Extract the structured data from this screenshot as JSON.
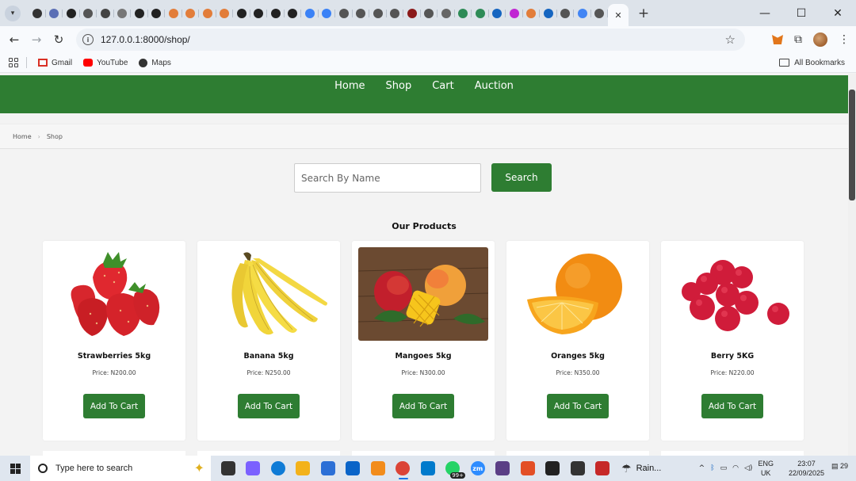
{
  "browser": {
    "tab_menu_icon": "chevron-down-icon",
    "active_tab_close_icon": "close-icon",
    "new_tab_label": "+",
    "window_controls": {
      "minimize": "—",
      "maximize": "☐",
      "close": "✕"
    },
    "url": "127.0.0.1:8000/shop/",
    "mini_tab_colors": [
      "#333333",
      "#5b6fb5",
      "#222222",
      "#555555",
      "#444444",
      "#777777",
      "#222222",
      "#222222",
      "#e27d3a",
      "#e27d3a",
      "#e27d3a",
      "#e27d3a",
      "#222222",
      "#222222",
      "#222222",
      "#222222",
      "#3b82f6",
      "#3b82f6",
      "#555555",
      "#555555",
      "#555555",
      "#555555",
      "#8b1a1a",
      "#555555",
      "#666666",
      "#2e8b57",
      "#2e8b57",
      "#1565c0",
      "#c026d3",
      "#e27d3a",
      "#1565c0",
      "#555555",
      "#4285f4",
      "#555555"
    ],
    "bookmarks": [
      {
        "label": "Gmail",
        "icon": "gmail-icon",
        "color": "#d93025"
      },
      {
        "label": "YouTube",
        "icon": "youtube-icon",
        "color": "#ff0000"
      },
      {
        "label": "Maps",
        "icon": "globe-icon",
        "color": "#333333"
      }
    ],
    "all_bookmarks_label": "All Bookmarks"
  },
  "site": {
    "nav": [
      "Home",
      "Shop",
      "Cart",
      "Auction"
    ],
    "breadcrumb": [
      "Home",
      "Shop"
    ],
    "breadcrumb_separator": "›",
    "search_placeholder": "Search By Name",
    "search_button": "Search",
    "section_title": "Our Products",
    "accent_color": "#2e7d32",
    "products": [
      {
        "name": "Strawberries 5kg",
        "price": "Price: N200.00",
        "button": "Add To Cart",
        "image": "strawberries-image"
      },
      {
        "name": "Banana 5kg",
        "price": "Price: N250.00",
        "button": "Add To Cart",
        "image": "banana-image"
      },
      {
        "name": "Mangoes 5kg",
        "price": "Price: N300.00",
        "button": "Add To Cart",
        "image": "mangoes-image"
      },
      {
        "name": "Oranges 5kg",
        "price": "Price: N350.00",
        "button": "Add To Cart",
        "image": "oranges-image"
      },
      {
        "name": "Berry 5KG",
        "price": "Price: N220.00",
        "button": "Add To Cart",
        "image": "raspberries-image"
      }
    ]
  },
  "taskbar": {
    "search_placeholder": "Type here to search",
    "apps": [
      {
        "name": "task-view-icon",
        "color": "#333333"
      },
      {
        "name": "copilot-icon",
        "color": "#7b61ff"
      },
      {
        "name": "edge-icon",
        "color": "#0f7bd6"
      },
      {
        "name": "file-explorer-icon",
        "color": "#f3b21b"
      },
      {
        "name": "store-icon",
        "color": "#2b6fd6"
      },
      {
        "name": "outlook-icon",
        "color": "#0a64c8"
      },
      {
        "name": "sublime-icon",
        "color": "#f28c1b"
      },
      {
        "name": "chrome-icon",
        "color": "#db4437"
      },
      {
        "name": "vscode-icon",
        "color": "#007acc"
      },
      {
        "name": "whatsapp-icon",
        "color": "#25d366"
      },
      {
        "name": "zoom-icon",
        "color": "#2d8cff"
      },
      {
        "name": "git-icon",
        "color": "#5a3e85"
      },
      {
        "name": "document-icon",
        "color": "#e34f26"
      },
      {
        "name": "terminal-icon",
        "color": "#222222"
      },
      {
        "name": "cmd-icon",
        "color": "#333333"
      },
      {
        "name": "app-icon",
        "color": "#c62828"
      }
    ],
    "whatsapp_badge": "99+",
    "zoom_label": "zm",
    "weather": "Rain...",
    "language": [
      "ENG",
      "UK"
    ],
    "time": "23:07",
    "date": "22/09/2025",
    "notifications": "29"
  }
}
